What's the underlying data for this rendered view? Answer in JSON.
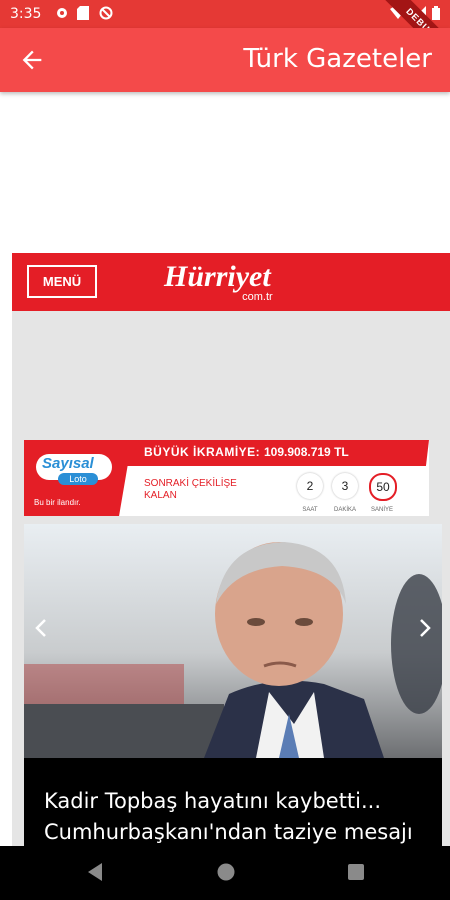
{
  "status_bar": {
    "time": "3:35",
    "left_icons": [
      "gear-icon",
      "sd-card-icon",
      "circle-slash-icon"
    ],
    "right_icons": [
      "wifi-icon",
      "signal-icon",
      "battery-icon"
    ],
    "debug_label": "DEBUG"
  },
  "app_bar": {
    "title": "Türk Gazeteler",
    "back_icon": "arrow-back-icon"
  },
  "site": {
    "menu_label": "MENÜ",
    "logo_text": "Hürriyet",
    "logo_sub": "com.tr"
  },
  "lottery": {
    "logo_text": "Sayısal",
    "logo_sub": "Loto",
    "note": "Bu bir ilandır.",
    "jackpot_label": "BÜYÜK İKRAMİYE:",
    "jackpot_value": "109.908.719 TL",
    "draw_label": "SONRAKİ ÇEKİLİŞE KALAN",
    "countdown": [
      {
        "value": "2",
        "unit": "SAAT"
      },
      {
        "value": "3",
        "unit": "DAKİKA"
      },
      {
        "value": "50",
        "unit": "SANİYE"
      }
    ]
  },
  "slider": {
    "headline": "Kadir Topbaş hayatını kaybetti... Cumhurbaşkanı'ndan taziye mesajı"
  },
  "nav_bar": {
    "icons": [
      "back-triangle-icon",
      "home-circle-icon",
      "recents-square-icon"
    ]
  }
}
